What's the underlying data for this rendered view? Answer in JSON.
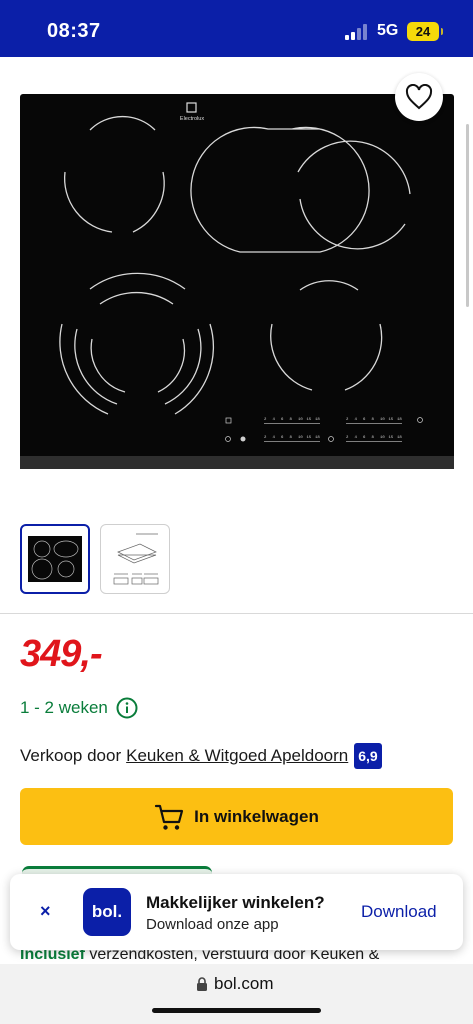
{
  "status_bar": {
    "time": "08:37",
    "network": "5G",
    "battery": "24"
  },
  "product": {
    "image_brand": "Electrolux",
    "hob_labels": [
      "2",
      "4",
      "6",
      "8",
      "10",
      "15",
      "18"
    ],
    "price": "349,-",
    "delivery": "1 - 2 weken",
    "seller_prefix": "Verkoop door",
    "seller_name": "Keuken & Witgoed Apeldoorn",
    "seller_rating": "6,9",
    "cart_label": "In winkelwagen",
    "shipping_bold": "Inclusief",
    "shipping_text": " verzendkosten, verstuurd door Keuken &"
  },
  "app_banner": {
    "close_icon": "×",
    "logo": "bol.",
    "title": "Makkelijker winkelen?",
    "subtitle": "Download onze app",
    "action": "Download"
  },
  "browser": {
    "url": "bol.com"
  },
  "colors": {
    "brand_blue": "#0b1fa8",
    "price_red": "#e0151b",
    "cart_yellow": "#fcbf12",
    "delivery_green": "#0a7d3b"
  }
}
